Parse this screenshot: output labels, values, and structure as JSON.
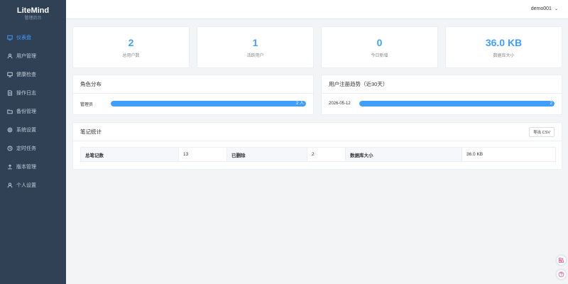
{
  "brand": {
    "title": "LiteMind",
    "subtitle": "管理后台"
  },
  "sidebar": {
    "items": [
      {
        "label": "仪表盘",
        "icon": "dashboard-icon",
        "active": true
      },
      {
        "label": "用户管理",
        "icon": "user-icon"
      },
      {
        "label": "健康检查",
        "icon": "monitor-icon"
      },
      {
        "label": "操作日志",
        "icon": "document-icon"
      },
      {
        "label": "备份管理",
        "icon": "folder-icon"
      },
      {
        "label": "系统设置",
        "icon": "gear-icon"
      },
      {
        "label": "定时任务",
        "icon": "clock-icon"
      },
      {
        "label": "版本管理",
        "icon": "upload-icon"
      },
      {
        "label": "个人设置",
        "icon": "person-icon"
      }
    ]
  },
  "header": {
    "user": "demo001",
    "chevron": "⌄"
  },
  "stats": [
    {
      "value": "2",
      "label": "总用户数"
    },
    {
      "value": "1",
      "label": "活跃用户"
    },
    {
      "value": "0",
      "label": "今日新增"
    },
    {
      "value": "36.0 KB",
      "label": "数据库大小"
    }
  ],
  "roles": {
    "title": "角色分布",
    "rows": [
      {
        "label": "管理员",
        "text": "2 人",
        "percent": 100
      }
    ]
  },
  "trend": {
    "title": "用户注册趋势（近30天）",
    "rows": [
      {
        "label": "2026-05-12",
        "text": "2",
        "percent": 100
      }
    ]
  },
  "notes": {
    "title": "笔记统计",
    "export_label": "导出 CSV",
    "cells": [
      {
        "key": "总笔记数",
        "value": "13"
      },
      {
        "key": "已删除",
        "value": "2"
      },
      {
        "key": "数据库大小",
        "value": "36.0 KB"
      }
    ]
  },
  "colors": {
    "sidebar": "#304156",
    "accent": "#409eff",
    "background": "#f3f4f6"
  },
  "floating": [
    {
      "icon": "apps-icon"
    },
    {
      "icon": "help-icon"
    }
  ]
}
